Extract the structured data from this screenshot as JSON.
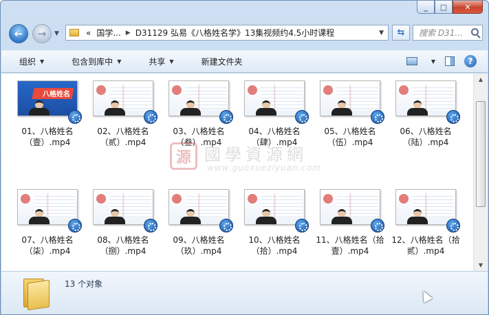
{
  "window": {
    "caption_buttons": [
      "minimize",
      "maximize",
      "close"
    ]
  },
  "nav": {
    "breadcrumbs": [
      "«",
      "国学...",
      "D31129 弘易《八格姓名学》13集视频约4.5小时课程"
    ],
    "search_placeholder": "搜索 D31..."
  },
  "toolbar": {
    "organize": "组织",
    "include_in_library": "包含到库中",
    "share": "共享",
    "new_folder": "新建文件夹"
  },
  "banner_text": "八格姓名",
  "files": [
    {
      "name": "01、八格姓名（壹）.mp4",
      "icon": "video-file-icon"
    },
    {
      "name": "02、八格姓名（贰）.mp4",
      "icon": "video-file-icon"
    },
    {
      "name": "03、八格姓名（叁）.mp4",
      "icon": "video-file-icon"
    },
    {
      "name": "04、八格姓名（肆）.mp4",
      "icon": "video-file-icon"
    },
    {
      "name": "05、八格姓名（伍）.mp4",
      "icon": "video-file-icon"
    },
    {
      "name": "06、八格姓名（陆）.mp4",
      "icon": "video-file-icon"
    },
    {
      "name": "07、八格姓名（柒）.mp4",
      "icon": "video-file-icon"
    },
    {
      "name": "08、八格姓名（捌）.mp4",
      "icon": "video-file-icon"
    },
    {
      "name": "09、八格姓名（玖）.mp4",
      "icon": "video-file-icon"
    },
    {
      "name": "10、八格姓名（拾）.mp4",
      "icon": "video-file-icon"
    },
    {
      "name": "11、八格姓名（拾壹）.mp4",
      "icon": "video-file-icon"
    },
    {
      "name": "12、八格姓名（拾贰）.mp4",
      "icon": "video-file-icon"
    }
  ],
  "watermark": {
    "seal": "源",
    "title": "國學資源網",
    "url": "www.guoxueziyuan.com"
  },
  "status": {
    "count": "13 个对象"
  }
}
